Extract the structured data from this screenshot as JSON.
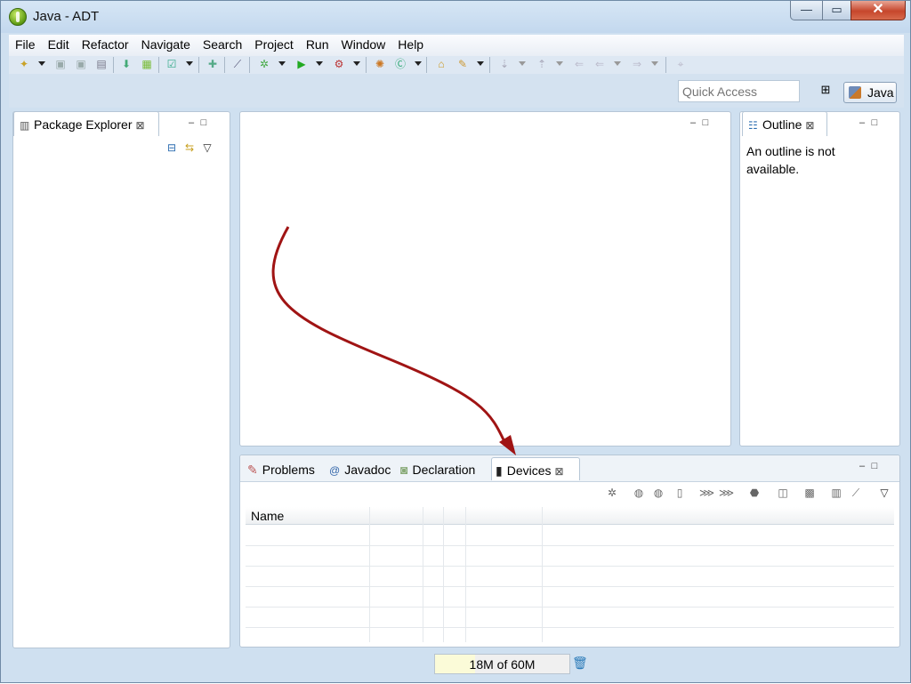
{
  "window": {
    "title": "Java - ADT",
    "close_glyph": "✕",
    "max_glyph": "▭",
    "min_glyph": "—"
  },
  "menu": [
    "File",
    "Edit",
    "Refactor",
    "Navigate",
    "Search",
    "Project",
    "Run",
    "Window",
    "Help"
  ],
  "toolbar2": {
    "quick_access_placeholder": "Quick Access",
    "perspective": "Java"
  },
  "package_explorer": {
    "tab": "Package Explorer"
  },
  "outline": {
    "tab": "Outline",
    "message": "An outline is not available."
  },
  "bottom_tabs": [
    {
      "label": "Problems",
      "icon": "problems-icon",
      "glyph": "✎"
    },
    {
      "label": "Javadoc",
      "icon": "javadoc-icon",
      "glyph": "@"
    },
    {
      "label": "Declaration",
      "icon": "declaration-icon",
      "glyph": "◙"
    },
    {
      "label": "Devices",
      "icon": "device-icon",
      "glyph": "▮"
    }
  ],
  "devices_table": {
    "columns": [
      "Name"
    ]
  },
  "status": {
    "heap": "18M of 60M",
    "heap_used_fraction": 0.3
  },
  "colors": {
    "arrow": "#a01414",
    "accent": "#2b6cb0"
  }
}
